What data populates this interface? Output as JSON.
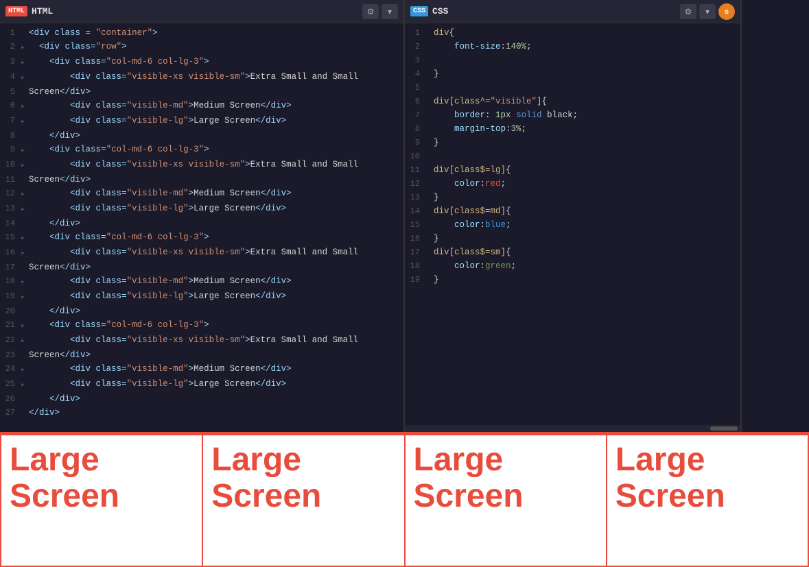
{
  "panels": {
    "html": {
      "tab_label": "HTML",
      "tab_icon": "HTML",
      "gear_label": "⚙",
      "chevron_label": "▾",
      "lines": [
        {
          "num": 1,
          "dot": "",
          "code": "<div class = \"container\">"
        },
        {
          "num": 2,
          "dot": "▸",
          "code": "  <div class=\"row\">"
        },
        {
          "num": 3,
          "dot": "▸",
          "code": "    <div class=\"col-md-6 col-lg-3\">"
        },
        {
          "num": 4,
          "dot": "▸",
          "code": "        <div class=\"visible-xs visible-sm\">Extra Small and Small"
        },
        {
          "num": 5,
          "dot": "",
          "code": "Screen</div>"
        },
        {
          "num": 6,
          "dot": "▸",
          "code": "        <div class=\"visible-md\">Medium Screen</div>"
        },
        {
          "num": 7,
          "dot": "▸",
          "code": "        <div class=\"visible-lg\">Large Screen</div>"
        },
        {
          "num": 8,
          "dot": "",
          "code": "    </div>"
        },
        {
          "num": 9,
          "dot": "▸",
          "code": "    <div class=\"col-md-6 col-lg-3\">"
        },
        {
          "num": 10,
          "dot": "▸",
          "code": "        <div class=\"visible-xs visible-sm\">Extra Small and Small"
        },
        {
          "num": 11,
          "dot": "",
          "code": "Screen</div>"
        },
        {
          "num": 12,
          "dot": "▸",
          "code": "        <div class=\"visible-md\">Medium Screen</div>"
        },
        {
          "num": 13,
          "dot": "▸",
          "code": "        <div class=\"visible-lg\">Large Screen</div>"
        },
        {
          "num": 14,
          "dot": "",
          "code": "    </div>"
        },
        {
          "num": 15,
          "dot": "▸",
          "code": "    <div class=\"col-md-6 col-lg-3\">"
        },
        {
          "num": 16,
          "dot": "▸",
          "code": "        <div class=\"visible-xs visible-sm\">Extra Small and Small"
        },
        {
          "num": 17,
          "dot": "",
          "code": "Screen</div>"
        },
        {
          "num": 18,
          "dot": "▸",
          "code": "        <div class=\"visible-md\">Medium Screen</div>"
        },
        {
          "num": 19,
          "dot": "▸",
          "code": "        <div class=\"visible-lg\">Large Screen</div>"
        },
        {
          "num": 20,
          "dot": "",
          "code": "    </div>"
        },
        {
          "num": 21,
          "dot": "▸",
          "code": "    <div class=\"col-md-6 col-lg-3\">"
        },
        {
          "num": 22,
          "dot": "▸",
          "code": "        <div class=\"visible-xs visible-sm\">Extra Small and Small"
        },
        {
          "num": 23,
          "dot": "",
          "code": "Screen</div>"
        },
        {
          "num": 24,
          "dot": "▸",
          "code": "        <div class=\"visible-md\">Medium Screen</div>"
        },
        {
          "num": 25,
          "dot": "▸",
          "code": "        <div class=\"visible-lg\">Large Screen</div>"
        },
        {
          "num": 26,
          "dot": "",
          "code": "    </div>"
        },
        {
          "num": 27,
          "dot": "",
          "code": "</div>"
        }
      ]
    },
    "css": {
      "tab_label": "CSS",
      "tab_icon": "CSS",
      "gear_label": "⚙",
      "chevron_label": "▾",
      "avatar_label": "s",
      "lines": [
        {
          "num": 1,
          "code": "div{"
        },
        {
          "num": 2,
          "code": "    font-size:140%;"
        },
        {
          "num": 3,
          "code": ""
        },
        {
          "num": 4,
          "code": "}"
        },
        {
          "num": 5,
          "code": ""
        },
        {
          "num": 6,
          "code": "div[class^=\"visible\"]{"
        },
        {
          "num": 7,
          "code": "    border: 1px solid black;"
        },
        {
          "num": 8,
          "code": "    margin-top:3%;"
        },
        {
          "num": 9,
          "code": "}"
        },
        {
          "num": 10,
          "code": ""
        },
        {
          "num": 11,
          "code": "div[class$=lg]{"
        },
        {
          "num": 12,
          "code": "    color:red;"
        },
        {
          "num": 13,
          "code": "}"
        },
        {
          "num": 14,
          "code": "div[class$=md]{"
        },
        {
          "num": 15,
          "code": "    color:blue;"
        },
        {
          "num": 16,
          "code": "}"
        },
        {
          "num": 17,
          "code": "div[class$=sm]{"
        },
        {
          "num": 18,
          "code": "    color:green;"
        },
        {
          "num": 19,
          "code": "}"
        }
      ]
    }
  },
  "preview": {
    "boxes": [
      {
        "label": "Large Screen"
      },
      {
        "label": "Large Screen"
      },
      {
        "label": "Large Screen"
      },
      {
        "label": "Large Screen"
      }
    ]
  }
}
